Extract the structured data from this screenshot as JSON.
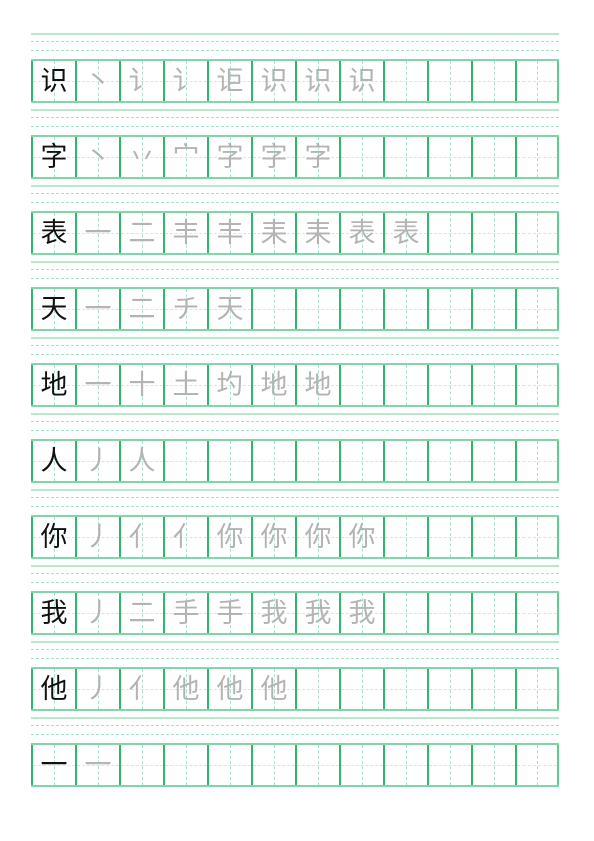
{
  "worksheet": {
    "title": "",
    "cells_per_row": 12,
    "colors": {
      "grid_border": "#2cb96a",
      "grid_outer": "#7fd6a6",
      "guide_dashed": "#a8e3c8",
      "model_char": "#111111",
      "trace_char": "#b4b4b4"
    },
    "rows": [
      {
        "character": "识",
        "strokes": [
          "丶",
          "讠",
          "讠",
          "讵",
          "识",
          "识",
          "识"
        ]
      },
      {
        "character": "字",
        "strokes": [
          "丶",
          "丷",
          "宀",
          "字",
          "字",
          "字"
        ]
      },
      {
        "character": "表",
        "strokes": [
          "一",
          "二",
          "丰",
          "丰",
          "耒",
          "耒",
          "表",
          "表"
        ]
      },
      {
        "character": "天",
        "strokes": [
          "一",
          "二",
          "チ",
          "天"
        ]
      },
      {
        "character": "地",
        "strokes": [
          "一",
          "十",
          "土",
          "圴",
          "地",
          "地"
        ]
      },
      {
        "character": "人",
        "strokes": [
          "丿",
          "人"
        ]
      },
      {
        "character": "你",
        "strokes": [
          "丿",
          "亻",
          "亻",
          "你",
          "你",
          "你",
          "你"
        ]
      },
      {
        "character": "我",
        "strokes": [
          "丿",
          "二",
          "手",
          "手",
          "我",
          "我",
          "我"
        ]
      },
      {
        "character": "他",
        "strokes": [
          "丿",
          "亻",
          "他",
          "他",
          "他"
        ]
      },
      {
        "character": "一",
        "strokes": [
          "一"
        ]
      }
    ]
  }
}
